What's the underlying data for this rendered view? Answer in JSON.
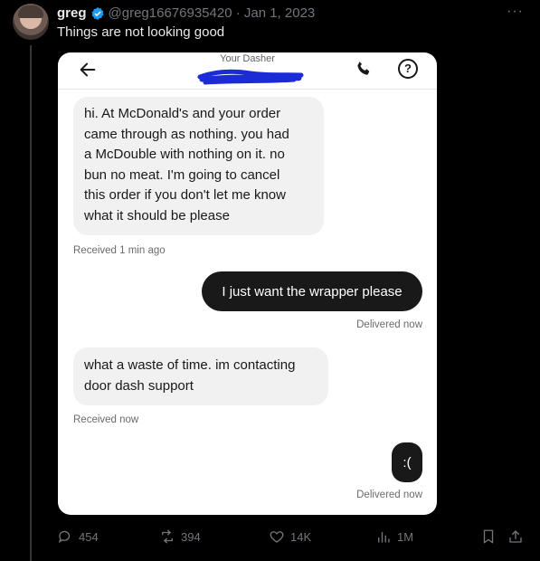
{
  "tweet": {
    "author_name": "greg",
    "handle_date": "@greg16676935420 · Jan 1, 2023",
    "text": "Things are not looking good"
  },
  "screenshot": {
    "header_label": "Your Dasher",
    "messages": [
      {
        "direction": "in",
        "lines": [
          "hi. At McDonald's and your order",
          "came through as nothing.  you had",
          "a McDouble with nothing on it. no",
          "bun no meat.  I'm going to cancel",
          "this order if you don't let me know",
          "what it should be please"
        ],
        "status": "Received 1 min ago"
      },
      {
        "direction": "out",
        "text": "I just want the wrapper please",
        "status": "Delivered now"
      },
      {
        "direction": "in",
        "lines": [
          "what a waste of time. im contacting",
          "door dash support"
        ],
        "status": "Received now"
      },
      {
        "direction": "out",
        "text": ":(",
        "status": "Delivered now"
      }
    ]
  },
  "actions": {
    "replies": "454",
    "reposts": "394",
    "likes": "14K",
    "views": "1M"
  },
  "icons": [
    "verified-badge-icon",
    "more-icon",
    "back-arrow-icon",
    "phone-icon",
    "help-icon",
    "reply-icon",
    "repost-icon",
    "like-icon",
    "views-icon",
    "bookmark-icon",
    "share-icon"
  ],
  "colors": {
    "verified_blue": "#1d9bf0",
    "redaction_blue": "#1b2bd6"
  }
}
